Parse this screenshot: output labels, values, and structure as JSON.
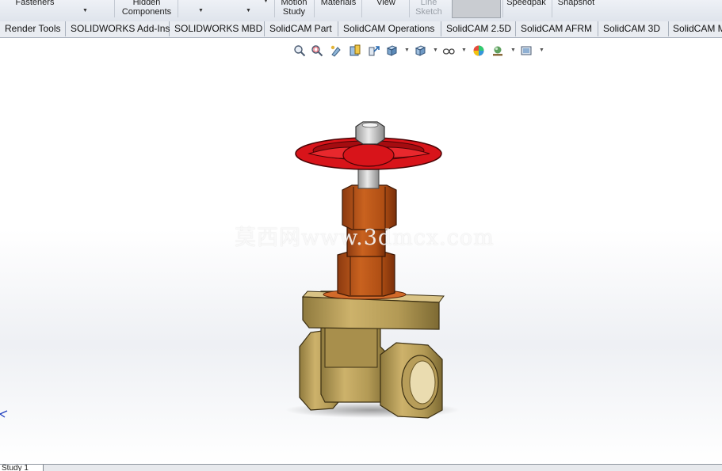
{
  "ribbon": {
    "buttons": [
      {
        "label": "Fasteners"
      },
      {
        "label": "Hidden Components"
      },
      {
        "label": "Motion Study"
      },
      {
        "label": "Materials"
      },
      {
        "label": "View"
      },
      {
        "label": "Line Sketch"
      },
      {
        "label": "Speedpak"
      },
      {
        "label": "Snapshot"
      }
    ]
  },
  "tabs": [
    {
      "label": "Render Tools"
    },
    {
      "label": "SOLIDWORKS Add-Ins"
    },
    {
      "label": "SOLIDWORKS MBD"
    },
    {
      "label": "SolidCAM Part"
    },
    {
      "label": "SolidCAM Operations"
    },
    {
      "label": "SolidCAM 2.5D"
    },
    {
      "label": "SolidCAM AFRM"
    },
    {
      "label": "SolidCAM 3D"
    },
    {
      "label": "SolidCAM M"
    }
  ],
  "hud": {
    "icons": [
      "zoom-to-fit-icon",
      "zoom-to-area-icon",
      "previous-view-icon",
      "section-view-icon",
      "dynamic-annotation-icon",
      "view-orientation-icon",
      "display-style-icon",
      "hide-show-items-icon",
      "edit-appearance-icon",
      "apply-scene-icon",
      "view-settings-icon"
    ]
  },
  "watermark": "莫西网www.3dmcx.com",
  "model": {
    "colors": {
      "handwheel": "#d8141a",
      "bonnet": "#b8551b",
      "body": "#c9ae6a",
      "nut": "#c6c6c6"
    }
  },
  "status": {
    "tab": "Study 1"
  }
}
